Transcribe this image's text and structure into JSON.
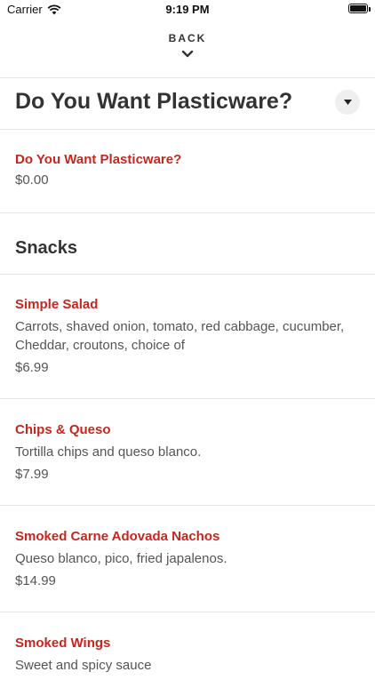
{
  "status": {
    "carrier": "Carrier",
    "time": "9:19 PM"
  },
  "nav": {
    "back_label": "BACK"
  },
  "plasticware": {
    "title": "Do You Want Plasticware?",
    "item_name": "Do You Want Plasticware?",
    "item_price": "$0.00"
  },
  "snacks": {
    "title": "Snacks",
    "items": [
      {
        "name": "Simple Salad",
        "desc": "Carrots, shaved onion, tomato, red cabbage, cucumber, Cheddar, croutons, choice of",
        "price": "$6.99"
      },
      {
        "name": "Chips & Queso",
        "desc": "Tortilla chips and queso blanco.",
        "price": "$7.99"
      },
      {
        "name": "Smoked Carne Adovada Nachos",
        "desc": "Queso blanco, pico, fried japalenos.",
        "price": "$14.99"
      },
      {
        "name": "Smoked Wings",
        "desc": "Sweet and spicy sauce"
      }
    ]
  },
  "colors": {
    "accent": "#c8261d",
    "divider": "#e6e6e6"
  },
  "icons": {
    "wifi": "wifi-icon",
    "battery": "battery-icon",
    "back": "chevron-down-icon",
    "dropdown": "triangle-down-icon"
  }
}
